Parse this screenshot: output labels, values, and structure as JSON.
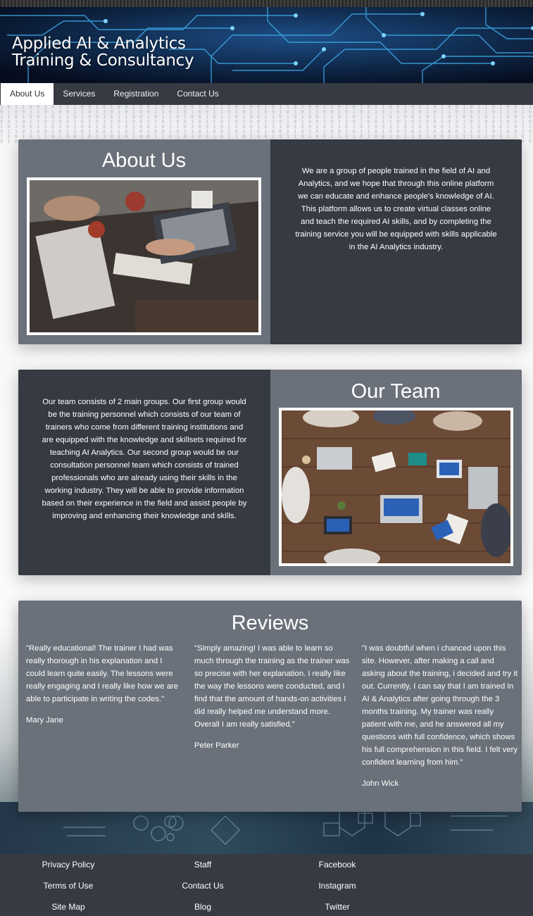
{
  "banner": {
    "title_line1": "Applied AI & Analytics",
    "title_line2": "Training & Consultancy"
  },
  "nav": {
    "items": [
      {
        "label": "About Us",
        "active": true
      },
      {
        "label": "Services",
        "active": false
      },
      {
        "label": "Registration",
        "active": false
      },
      {
        "label": "Contact Us",
        "active": false
      }
    ]
  },
  "about": {
    "heading": "About Us",
    "text": "We are a group of people trained in the field of AI and Analytics, and we hope that through this online platform we can educate and enhance people's knowledge of AI. This platform allows us to create virtual classes online and teach the required AI skills, and by completing the training service you will be equipped with skills applicable in the AI Analytics industry."
  },
  "team": {
    "heading": "Our Team",
    "text": "Our team consists of 2 main groups. Our first group would be the training personnel which consists of our team of trainers who come from different training institutions and are equipped with the knowledge and skillsets required for teaching AI Analytics. Our second group would be our consultation personnel team which consists of trained professionals who are already using their skills in the working industry. They will be able to provide information based on their experience in the field and assist people by improving and enhancing their knowledge and skills."
  },
  "reviews": {
    "heading": "Reviews",
    "items": [
      {
        "quote": "\"Really educational! The trainer I had was really thorough in his explanation and I could learn quite easily. The lessons were really engaging and I really like how we are able to participate in writing the codes.\"",
        "author": "Mary Jane"
      },
      {
        "quote": "\"Simply amazing! I was able to learn so much through the training as the trainer was so precise with her explanation. I really like the way the lessons were conducted, and I find that the amount of hands-on activities I did really helped me understand more. Overall I am really satisfied.\"",
        "author": "Peter Parker"
      },
      {
        "quote": "\"I was doubtful when i chanced upon this site. However, after making a call and asking about the training, i decided and try it out. Currently, I can say that I am trained in AI & Analytics after going through the 3 months training. My trainer was really patient with me, and he answered all my questions with full confidence, which shows his full comprehension in this field. I felt very confident learning from him.\"",
        "author": "John Wick"
      }
    ]
  },
  "footer": {
    "columns": [
      [
        "Privacy Policy",
        "Terms of Use",
        "Site Map"
      ],
      [
        "Staff",
        "Contact Us",
        "Blog"
      ],
      [
        "Facebook",
        "Instagram",
        "Twitter"
      ]
    ]
  },
  "colors": {
    "dark_panel": "#363a42",
    "light_panel": "#6b717a",
    "banner_circuit": "#3fa9e8"
  }
}
